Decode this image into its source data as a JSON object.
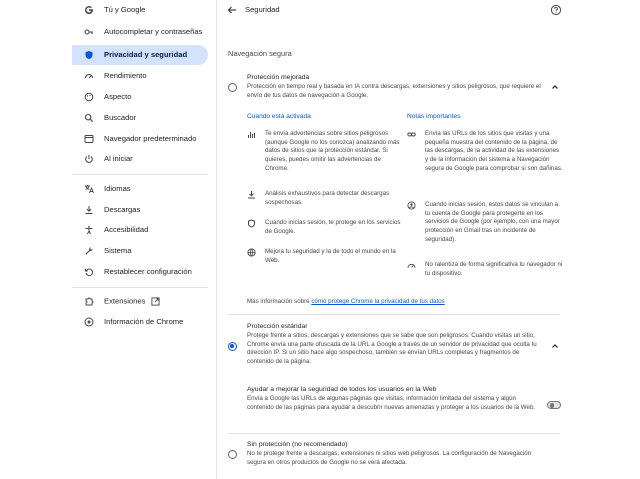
{
  "sidebar": {
    "items": [
      {
        "label": "Tú y Google",
        "icon": "google-g-icon"
      },
      {
        "label": "Autocompletar y contraseñas",
        "icon": "key-icon"
      },
      {
        "label": "Privacidad y seguridad",
        "icon": "shield-icon",
        "active": true
      },
      {
        "label": "Rendimiento",
        "icon": "speedometer-icon"
      },
      {
        "label": "Aspecto",
        "icon": "palette-icon"
      },
      {
        "label": "Buscador",
        "icon": "search-icon"
      },
      {
        "label": "Navegador predeterminado",
        "icon": "browser-icon"
      },
      {
        "label": "Al iniciar",
        "icon": "power-icon"
      },
      {
        "label": "Idiomas",
        "icon": "translate-icon"
      },
      {
        "label": "Descargas",
        "icon": "download-icon"
      },
      {
        "label": "Accesibilidad",
        "icon": "accessibility-icon"
      },
      {
        "label": "Sistema",
        "icon": "wrench-icon"
      },
      {
        "label": "Restablecer configuración",
        "icon": "reset-icon"
      },
      {
        "label": "Extensiones",
        "icon": "puzzle-icon"
      },
      {
        "label": "Información de Chrome",
        "icon": "chrome-icon"
      }
    ]
  },
  "header": {
    "title": "Seguridad",
    "back_icon": "back-arrow-icon",
    "help_icon": "help-icon"
  },
  "main": {
    "section_title": "Navegación segura",
    "enhanced": {
      "title": "Protección mejorada",
      "desc": "Protección en tiempo real y basada en IA contra descargas, extensiones y sitios peligrosos, que requiere el envío de tus datos de navegación a Google.",
      "left_head": "Cuando está activada",
      "right_head": "Notas importantes",
      "left_items": [
        {
          "icon": "chart-icon",
          "text": "Te envía advertencias sobre sitios peligrosos (aunque Google no los conozca) analizando más datos de sitios que la protección estándar. Si quieres, puedes omitir las advertencias de Chrome."
        },
        {
          "icon": "download-icon",
          "text": "Análisis exhaustivos para detectar descargas sospechosas."
        },
        {
          "icon": "shield-icon",
          "text": "Cuando inicias sesión, te protege en los servicios de Google."
        },
        {
          "icon": "globe-icon",
          "text": "Mejora tu seguridad y la de todo el mundo en la Web."
        }
      ],
      "right_items": [
        {
          "icon": "link-icon",
          "text": "Envía las URLs de los sitios que visitas y una pequeña muestra del contenido de la página, de las descargas, de la actividad de las extensiones y de la información del sistema a Navegación segura de Google para comprobar si son dañinas."
        },
        {
          "icon": "account-icon",
          "text": "Cuando inicias sesión, estos datos se vinculan a tu cuenta de Google para protegerte en los servicios de Google (por ejemplo, con una mayor protección en Gmail tras un incidente de seguridad)."
        },
        {
          "icon": "speed-icon",
          "text": "No ralentiza de forma significativa tu navegador ni tu dispositivo."
        }
      ],
      "more_prefix": "Más información sobre ",
      "more_link": "cómo protege Chrome la privacidad de tus datos"
    },
    "standard": {
      "title": "Protección estándar",
      "desc": "Protege frente a sitios, descargas y extensiones que se sabe que son peligrosos. Cuando visitas un sitio, Chrome envía una parte ofuscada de la URL a Google a través de un servidor de privacidad que oculta tu dirección IP. Si un sitio hace algo sospechoso, también se envían URLs completas y fragmentos de contenido de la página.",
      "help_title": "Ayudar a mejorar la seguridad de todos los usuarios en la Web",
      "help_desc": "Envía a Google las URLs de algunas páginas que visitas, información limitada del sistema y algún contenido de las páginas para ayudar a descubrir nuevas amenazas y proteger a los usuarios de la Web."
    },
    "none": {
      "title": "Sin protección (no recomendado)",
      "desc": "No te protege frente a descargas, extensiones ni sitios web peligrosos. La configuración de Navegación segura en otros productos de Google no se verá afectada."
    }
  }
}
